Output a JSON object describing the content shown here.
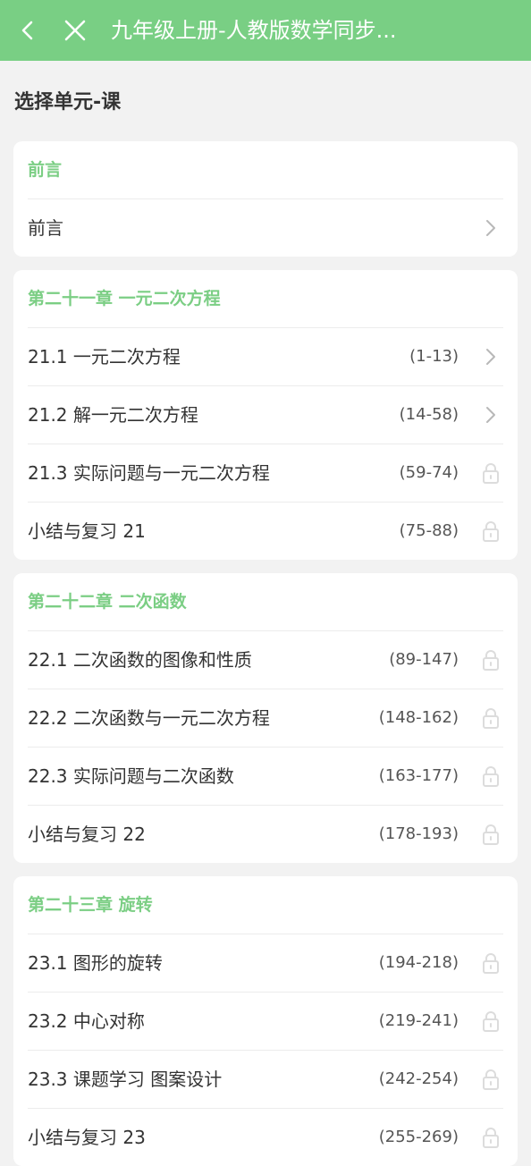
{
  "header": {
    "title": "九年级上册-人教版数学同步...",
    "back_icon": "chevron-left-icon",
    "close_icon": "close-icon",
    "bg_color": "#79cf84"
  },
  "section_title": "选择单元-课",
  "accent_color": "#7bce84",
  "units": [
    {
      "title": "前言",
      "lessons": [
        {
          "label": "前言",
          "pages": "",
          "state": "open"
        }
      ]
    },
    {
      "title": "第二十一章 一元二次方程",
      "lessons": [
        {
          "label": "21.1 一元二次方程",
          "pages": "(1-13)",
          "state": "open"
        },
        {
          "label": "21.2 解一元二次方程",
          "pages": "(14-58)",
          "state": "open"
        },
        {
          "label": "21.3 实际问题与一元二次方程",
          "pages": "(59-74)",
          "state": "locked"
        },
        {
          "label": "小结与复习 21",
          "pages": "(75-88)",
          "state": "locked"
        }
      ]
    },
    {
      "title": "第二十二章  二次函数",
      "lessons": [
        {
          "label": "22.1 二次函数的图像和性质",
          "pages": "(89-147)",
          "state": "locked"
        },
        {
          "label": "22.2 二次函数与一元二次方程",
          "pages": "(148-162)",
          "state": "locked"
        },
        {
          "label": "22.3 实际问题与二次函数",
          "pages": "(163-177)",
          "state": "locked"
        },
        {
          "label": "小结与复习 22",
          "pages": "(178-193)",
          "state": "locked"
        }
      ]
    },
    {
      "title": "第二十三章 旋转",
      "lessons": [
        {
          "label": "23.1 图形的旋转",
          "pages": "(194-218)",
          "state": "locked"
        },
        {
          "label": "23.2 中心对称",
          "pages": "(219-241)",
          "state": "locked"
        },
        {
          "label": "23.3 课题学习 图案设计",
          "pages": "(242-254)",
          "state": "locked"
        },
        {
          "label": "小结与复习 23",
          "pages": "(255-269)",
          "state": "locked"
        }
      ]
    }
  ]
}
